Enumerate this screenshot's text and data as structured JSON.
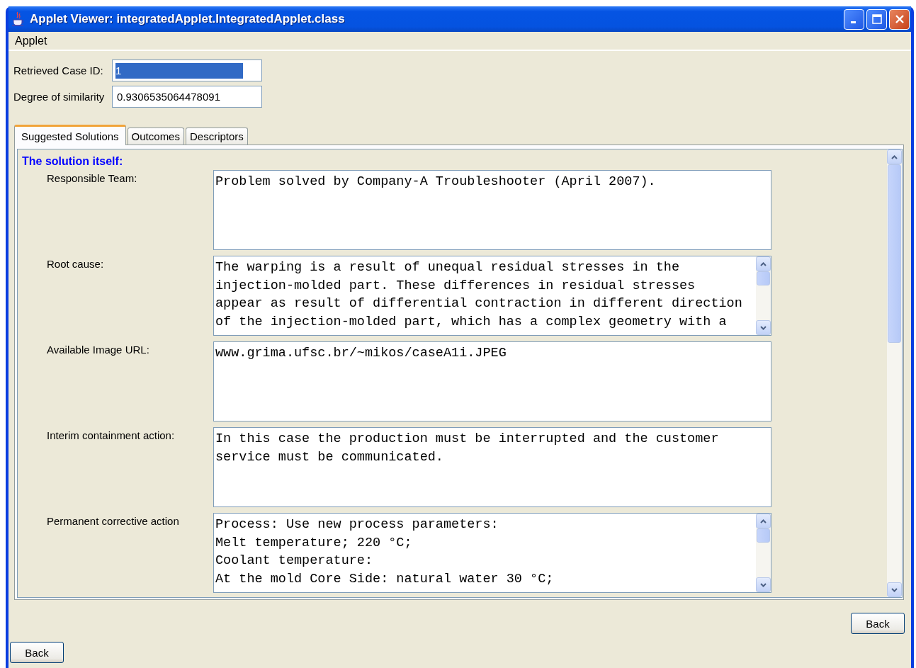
{
  "window": {
    "title": "Applet Viewer: integratedApplet.IntegratedApplet.class"
  },
  "menu": [
    "Applet"
  ],
  "fields": [
    {
      "label": "Retrieved Case ID:",
      "value": "1",
      "highlighted": true
    },
    {
      "label": "Degree of similarity",
      "value": "0.9306535064478091",
      "highlighted": false
    }
  ],
  "tabs": [
    {
      "label": "Suggested Solutions",
      "selected": true
    },
    {
      "label": "Outcomes",
      "selected": false
    },
    {
      "label": "Descriptors",
      "selected": false
    }
  ],
  "section_title": "The solution itself:",
  "solution_rows": [
    {
      "label": "Responsible Team:",
      "kind": "plain",
      "lines": [
        "Problem solved by Company-A Troubleshooter (April 2007)."
      ]
    },
    {
      "label": "Root cause:",
      "kind": "scrolling",
      "lines": [
        "The warping is a result of unequal residual stresses in the",
        "injection-molded part. These differences in residual stresses",
        "appear as result of differential contraction in different direction",
        "of the injection-molded part, which has a complex geometry with a"
      ]
    },
    {
      "label": "Available Image URL:",
      "kind": "plain",
      "lines": [
        "www.grima.ufsc.br/~mikos/caseA1i.JPEG"
      ]
    },
    {
      "label": "Interim containment action:",
      "kind": "plain",
      "lines": [
        "In this case the production must be interrupted and the customer",
        "service must be communicated."
      ]
    },
    {
      "label": "Permanent corrective action",
      "kind": "scrolling",
      "lines": [
        "Process: Use new process parameters:",
        "Melt temperature; 220 °C;",
        "Coolant temperature:",
        "At the mold Core Side: natural water 30 °C;"
      ]
    }
  ],
  "buttons": [
    {
      "label": "Back",
      "kind": "panel"
    },
    {
      "label": "Back",
      "kind": "window"
    }
  ]
}
